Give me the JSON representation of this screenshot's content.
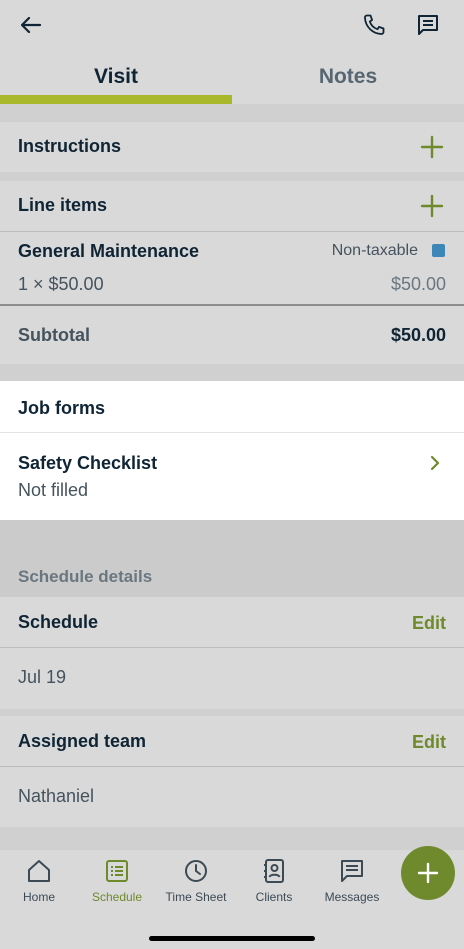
{
  "tabs": {
    "visit": "Visit",
    "notes": "Notes"
  },
  "instructions": {
    "label": "Instructions"
  },
  "line_items": {
    "label": "Line items",
    "item": {
      "name": "General Maintenance",
      "tax": "Non-taxable",
      "qty_price": "1 × $50.00",
      "total": "$50.00"
    },
    "subtotal_label": "Subtotal",
    "subtotal_value": "$50.00"
  },
  "job_forms": {
    "label": "Job forms",
    "form": {
      "name": "Safety Checklist",
      "status": "Not filled"
    }
  },
  "schedule_details": {
    "header": "Schedule details",
    "schedule_label": "Schedule",
    "schedule_edit": "Edit",
    "schedule_date": "Jul 19",
    "team_label": "Assigned team",
    "team_edit": "Edit",
    "team_member": "Nathaniel"
  },
  "nav": {
    "items": [
      {
        "label": "Home",
        "icon": "home-icon"
      },
      {
        "label": "Schedule",
        "icon": "schedule-icon"
      },
      {
        "label": "Time Sheet",
        "icon": "clock-icon"
      },
      {
        "label": "Clients",
        "icon": "contacts-icon"
      },
      {
        "label": "Messages",
        "icon": "messages-icon"
      }
    ]
  },
  "colors": {
    "accent": "#a9b72a",
    "green": "#6e8a2c",
    "tax_badge": "#3d86b8",
    "overlay_bg": "#d9d9d9"
  }
}
